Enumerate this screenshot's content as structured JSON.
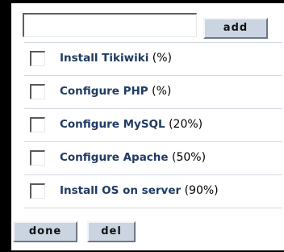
{
  "input": {
    "value": "",
    "placeholder": ""
  },
  "buttons": {
    "add": "add",
    "done": "done",
    "del": "del"
  },
  "tasks": [
    {
      "name": "Install Tikiwiki",
      "progress": "(%)",
      "checked": false
    },
    {
      "name": "Configure PHP",
      "progress": "(%)",
      "checked": false
    },
    {
      "name": "Configure MySQL",
      "progress": "(20%)",
      "checked": false
    },
    {
      "name": "Configure Apache",
      "progress": "(50%)",
      "checked": false
    },
    {
      "name": "Install OS on server",
      "progress": "(90%)",
      "checked": false
    }
  ],
  "colors": {
    "background": "#000000",
    "panel": "#ffffff",
    "button": "#cbd4e1",
    "task_name": "#1f3b64"
  }
}
